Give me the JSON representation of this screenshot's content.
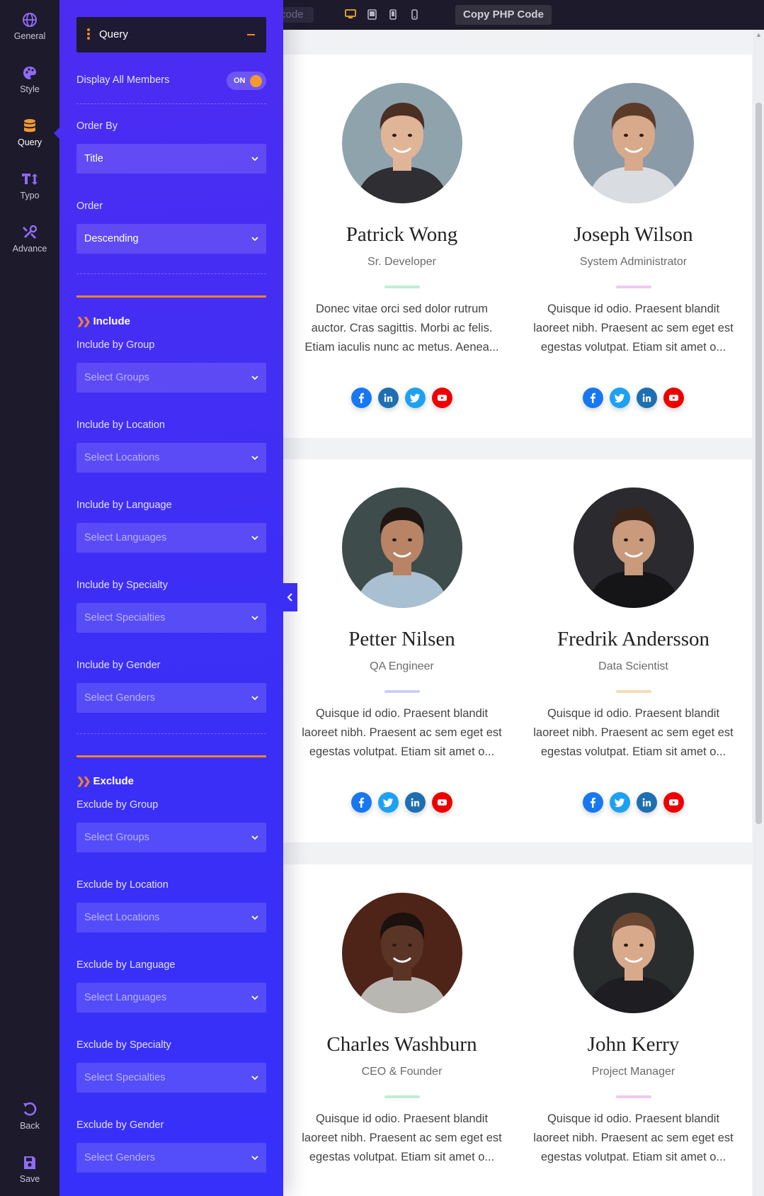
{
  "topbar": {
    "code_label": "code",
    "copy_button": "Copy PHP Code",
    "devices": [
      "desktop-icon",
      "tablet-icon",
      "tablet-small-icon",
      "mobile-icon"
    ]
  },
  "rail": {
    "items": [
      {
        "label": "General",
        "icon": "globe-icon"
      },
      {
        "label": "Style",
        "icon": "palette-icon"
      },
      {
        "label": "Query",
        "icon": "database-icon"
      },
      {
        "label": "Typo",
        "icon": "text-height-icon"
      },
      {
        "label": "Advance",
        "icon": "tools-icon"
      }
    ],
    "back": "Back",
    "save": "Save",
    "active": "Query"
  },
  "panel": {
    "section_title": "Query",
    "display_all_label": "Display All Members",
    "display_all_toggle": "ON",
    "order_by_label": "Order By",
    "order_by_value": "Title",
    "order_label": "Order",
    "order_value": "Descending",
    "include_title": "Include",
    "exclude_title": "Exclude",
    "include": [
      {
        "label": "Include by Group",
        "placeholder": "Select Groups"
      },
      {
        "label": "Include by Location",
        "placeholder": "Select Locations"
      },
      {
        "label": "Include by Language",
        "placeholder": "Select Languages"
      },
      {
        "label": "Include by Specialty",
        "placeholder": "Select Specialties"
      },
      {
        "label": "Include by Gender",
        "placeholder": "Select Genders"
      }
    ],
    "exclude": [
      {
        "label": "Exclude by Group",
        "placeholder": "Select Groups"
      },
      {
        "label": "Exclude by Location",
        "placeholder": "Select Locations"
      },
      {
        "label": "Exclude by Language",
        "placeholder": "Select Languages"
      },
      {
        "label": "Exclude by Specialty",
        "placeholder": "Select Specialties"
      },
      {
        "label": "Exclude by Gender",
        "placeholder": "Select Genders"
      }
    ]
  },
  "members": [
    {
      "name": "Patrick Wong",
      "role": "Sr. Developer",
      "accent": "#bfeed3",
      "bio": "Donec vitae orci sed dolor rutrum auctor. Cras sagittis. Morbi ac felis. Etiam iaculis nunc ac metus. Aenea...",
      "social": [
        "facebook",
        "linkedin",
        "twitter",
        "youtube"
      ],
      "avatar": {
        "bg": "#8fa3ad",
        "skin": "#e0b497",
        "hair": "#4a2f22",
        "shirt": "#2f2f33"
      }
    },
    {
      "name": "Joseph Wilson",
      "role": "System Administrator",
      "accent": "#f1c9f0",
      "bio": "Quisque id odio. Praesent blandit laoreet nibh. Praesent ac sem eget est egestas volutpat. Etiam sit amet o...",
      "social": [
        "facebook",
        "twitter",
        "linkedin",
        "youtube"
      ],
      "avatar": {
        "bg": "#8a9aa6",
        "skin": "#d8a98a",
        "hair": "#5b3b28",
        "shirt": "#d9dde2"
      }
    },
    {
      "name": "Petter Nilsen",
      "role": "QA Engineer",
      "accent": "#c9cff4",
      "bio": "Quisque id odio. Praesent blandit laoreet nibh. Praesent ac sem eget est egestas volutpat. Etiam sit amet o...",
      "social": [
        "facebook",
        "twitter",
        "linkedin",
        "youtube"
      ],
      "avatar": {
        "bg": "#3f4c4c",
        "skin": "#b98466",
        "hair": "#1f1612",
        "shirt": "#a9bfd2"
      }
    },
    {
      "name": "Fredrik Andersson",
      "role": "Data Scientist",
      "accent": "#f4dcb6",
      "bio": "Quisque id odio. Praesent blandit laoreet nibh. Praesent ac sem eget est egestas volutpat. Etiam sit amet o...",
      "social": [
        "facebook",
        "twitter",
        "linkedin",
        "youtube"
      ],
      "avatar": {
        "bg": "#2a2a2f",
        "skin": "#c99a7c",
        "hair": "#3a2418",
        "shirt": "#151517"
      }
    },
    {
      "name": "Charles Washburn",
      "role": "CEO & Founder",
      "accent": "#bfeed3",
      "bio": "Quisque id odio. Praesent blandit laoreet nibh. Praesent ac sem eget est egestas volutpat. Etiam sit amet o...",
      "social": [],
      "avatar": {
        "bg": "#4e2418",
        "skin": "#5a3526",
        "hair": "#1b110d",
        "shirt": "#b9b7b2"
      }
    },
    {
      "name": "John Kerry",
      "role": "Project Manager",
      "accent": "#f1c9f0",
      "bio": "Quisque id odio. Praesent blandit laoreet nibh. Praesent ac sem eget est egestas volutpat. Etiam sit amet o...",
      "social": [],
      "avatar": {
        "bg": "#2a2d2e",
        "skin": "#d9a98b",
        "hair": "#6b4630",
        "shirt": "#1e1e22"
      }
    }
  ],
  "colors": {
    "facebook": "#1877f2",
    "linkedin": "#1d6fb1",
    "twitter": "#1da1f2",
    "youtube": "#ee0000"
  }
}
